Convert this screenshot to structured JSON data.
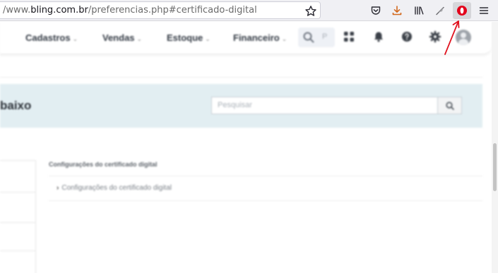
{
  "browser": {
    "url_host_prefix": "/www.",
    "url_host": "bling.com.br",
    "url_path": "/preferencias.php#certificado-digital",
    "toolbar_icons": [
      "bookmark-star-icon",
      "pocket-icon",
      "download-icon",
      "library-icon",
      "feather-icon",
      "opera-o-icon",
      "hamburger-menu-icon"
    ],
    "accent_opera": "#e3001b",
    "annotation_color": "#e0121e"
  },
  "nav": {
    "items": [
      {
        "label": "Cadastros"
      },
      {
        "label": "Vendas"
      },
      {
        "label": "Estoque"
      },
      {
        "label": "Financeiro"
      }
    ],
    "search_placeholder": "P",
    "icons": [
      "apps-grid-icon",
      "bell-icon",
      "help-icon",
      "gear-icon",
      "avatar"
    ]
  },
  "header": {
    "title": "baixo",
    "search_placeholder": "Pesquisar"
  },
  "content": {
    "section_title": "Configurações do certificado digital",
    "accordion_label": "Configurações do certificado digital"
  }
}
